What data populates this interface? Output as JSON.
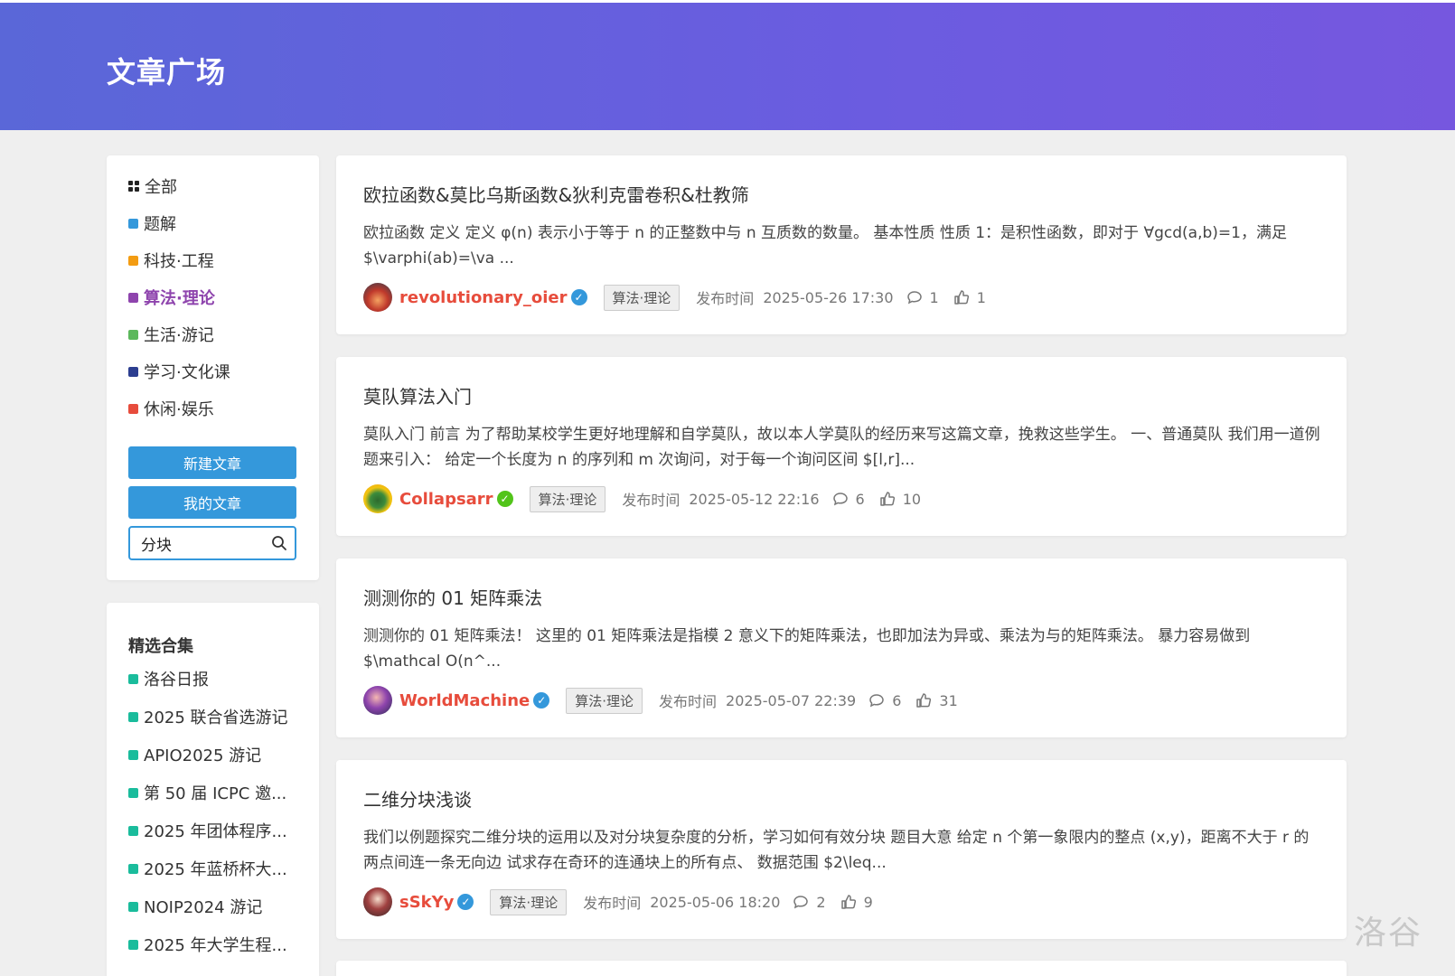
{
  "page": {
    "title": "文章广场"
  },
  "categories": [
    {
      "label": "全部",
      "color": "#222222",
      "icon": "grid-icon"
    },
    {
      "label": "题解",
      "color": "#3498db"
    },
    {
      "label": "科技·工程",
      "color": "#f39c12"
    },
    {
      "label": "算法·理论",
      "color": "#8e44ad",
      "active": true
    },
    {
      "label": "生活·游记",
      "color": "#5cb85c"
    },
    {
      "label": "学习·文化课",
      "color": "#2c3e90"
    },
    {
      "label": "休闲·娱乐",
      "color": "#e74c3c"
    }
  ],
  "buttons": {
    "new_article": "新建文章",
    "my_articles": "我的文章"
  },
  "search": {
    "value": "分块",
    "icon": "search-icon"
  },
  "collections": {
    "heading": "精选合集",
    "items": [
      "洛谷日报",
      "2025 联合省选游记",
      "APIO2025 游记",
      "第 50 届 ICPC 邀...",
      "2025 年团体程序...",
      "2025 年蓝桥杯大...",
      "NOIP2024 游记",
      "2025 年大学生程..."
    ]
  },
  "articles": [
    {
      "title": "欧拉函数&莫比乌斯函数&狄利克雷卷积&杜教筛",
      "summary": "欧拉函数 定义 定义 φ(n) 表示小于等于 n 的正整数中与 n 互质数的数量。 基本性质 性质 1：是积性函数，即对于 ∀gcd(a,b)=1，满足 $\\varphi(ab)=\\va ...",
      "author": "revolutionary_oier",
      "badge_color": "#3498db",
      "tag": "算法·理论",
      "time_label": "发布时间",
      "time": "2025-05-26 17:30",
      "comments": "1",
      "likes": "1"
    },
    {
      "title": "莫队算法入门",
      "summary": "莫队入门 前言 为了帮助某校学生更好地理解和自学莫队，故以本人学莫队的经历来写这篇文章，挽救这些学生。 一、普通莫队 我们用一道例题来引入： 给定一个长度为 n 的序列和 m 次询问，对于每一个询问区间 $[l,r]...",
      "author": "Collapsarr",
      "badge_color": "#52c41a",
      "tag": "算法·理论",
      "time_label": "发布时间",
      "time": "2025-05-12 22:16",
      "comments": "6",
      "likes": "10"
    },
    {
      "title": "测测你的 01 矩阵乘法",
      "summary": "测测你的 01 矩阵乘法！ 这里的 01 矩阵乘法是指模 2 意义下的矩阵乘法，也即加法为异或、乘法为与的矩阵乘法。 暴力容易做到 $\\mathcal O(n^...",
      "author": "WorldMachine",
      "badge_color": "#3498db",
      "tag": "算法·理论",
      "time_label": "发布时间",
      "time": "2025-05-07 22:39",
      "comments": "6",
      "likes": "31"
    },
    {
      "title": "二维分块浅谈",
      "summary": "我们以例题探究二维分块的运用以及对分块复杂度的分析，学习如何有效分块 题目大意 给定 n 个第一象限内的整点 (x,y)，距离不大于 r 的两点间连一条无向边 试求存在奇环的连通块上的所有点、 数据范围 $2\\leq...",
      "author": "sSkYy",
      "badge_color": "#3498db",
      "tag": "算法·理论",
      "time_label": "发布时间",
      "time": "2025-05-06 18:20",
      "comments": "2",
      "likes": "9"
    }
  ],
  "watermark": "洛谷"
}
